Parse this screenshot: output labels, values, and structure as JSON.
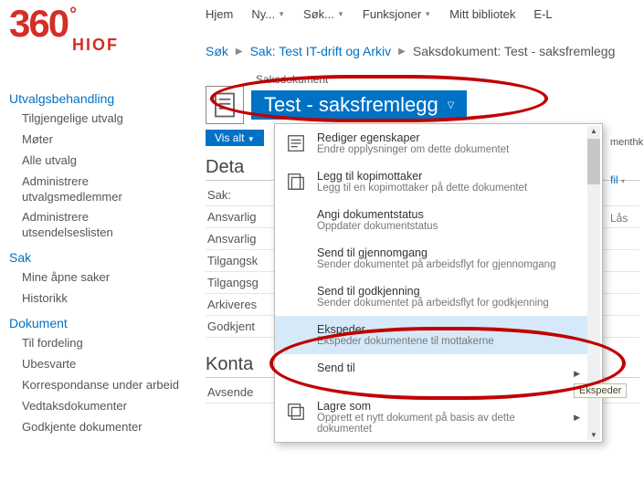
{
  "logo": {
    "brand": "360",
    "sub": "HIOF"
  },
  "topnav": [
    "Hjem",
    "Ny...",
    "Søk...",
    "Funksjoner",
    "Mitt bibliotek",
    "E-L"
  ],
  "breadcrumb": {
    "a": "Søk",
    "b": "Sak: Test IT-drift og Arkiv",
    "c": "Saksdokument: Test - saksfremlegg"
  },
  "sidebar": {
    "sections": [
      {
        "title": "Utvalgsbehandling",
        "items": [
          "Tilgjengelige utvalg",
          "Møter",
          "Alle utvalg",
          "Administrere utvalgsmedlemmer",
          "Administrere utsendelseslisten"
        ]
      },
      {
        "title": "Sak",
        "items": [
          "Mine åpne saker",
          "Historikk"
        ]
      },
      {
        "title": "Dokument",
        "items": [
          "Til fordeling",
          "Ubesvarte",
          "Korrespondanse under arbeid",
          "Vedtaksdokumenter",
          "Godkjente dokumenter"
        ]
      }
    ]
  },
  "doc": {
    "label": "Saksdokument",
    "title": "Test - saksfremlegg",
    "vis_alt": "Vis alt"
  },
  "details": {
    "heading": "Deta",
    "rows": [
      "Sak:",
      "Ansvarlig",
      "Ansvarlig",
      "Tilgangsk",
      "Tilgangsg",
      "Arkiveres",
      "Godkjent"
    ]
  },
  "kontakt": {
    "heading": "Konta",
    "row": "Avsende"
  },
  "rightstrip": {
    "a": "menthk",
    "b": "fil",
    "c": "Lås"
  },
  "menu": [
    {
      "icon": "props",
      "title": "Rediger egenskaper",
      "desc": "Endre opplysninger om dette dokumentet"
    },
    {
      "icon": "copyto",
      "title": "Legg til kopimottaker",
      "desc": "Legg til en kopimottaker på dette dokumentet"
    },
    {
      "icon": "",
      "title": "Angi dokumentstatus",
      "desc": "Oppdater dokumentstatus"
    },
    {
      "icon": "",
      "title": "Send til gjennomgang",
      "desc": "Sender dokumentet på arbeidsflyt for gjennomgang"
    },
    {
      "icon": "",
      "title": "Send til godkjenning",
      "desc": "Sender dokumentet på arbeidsflyt for godkjenning"
    },
    {
      "icon": "",
      "title": "Ekspeder",
      "desc": "Ekspeder dokumentene til mottakerne",
      "hover": true
    },
    {
      "icon": "",
      "title": "Send til",
      "desc": "",
      "submenu": true
    },
    {
      "icon": "saveas",
      "title": "Lagre som",
      "desc": "Opprett et nytt dokument på basis av dette dokumentet",
      "submenu": true
    }
  ],
  "tooltip": "Ekspeder"
}
